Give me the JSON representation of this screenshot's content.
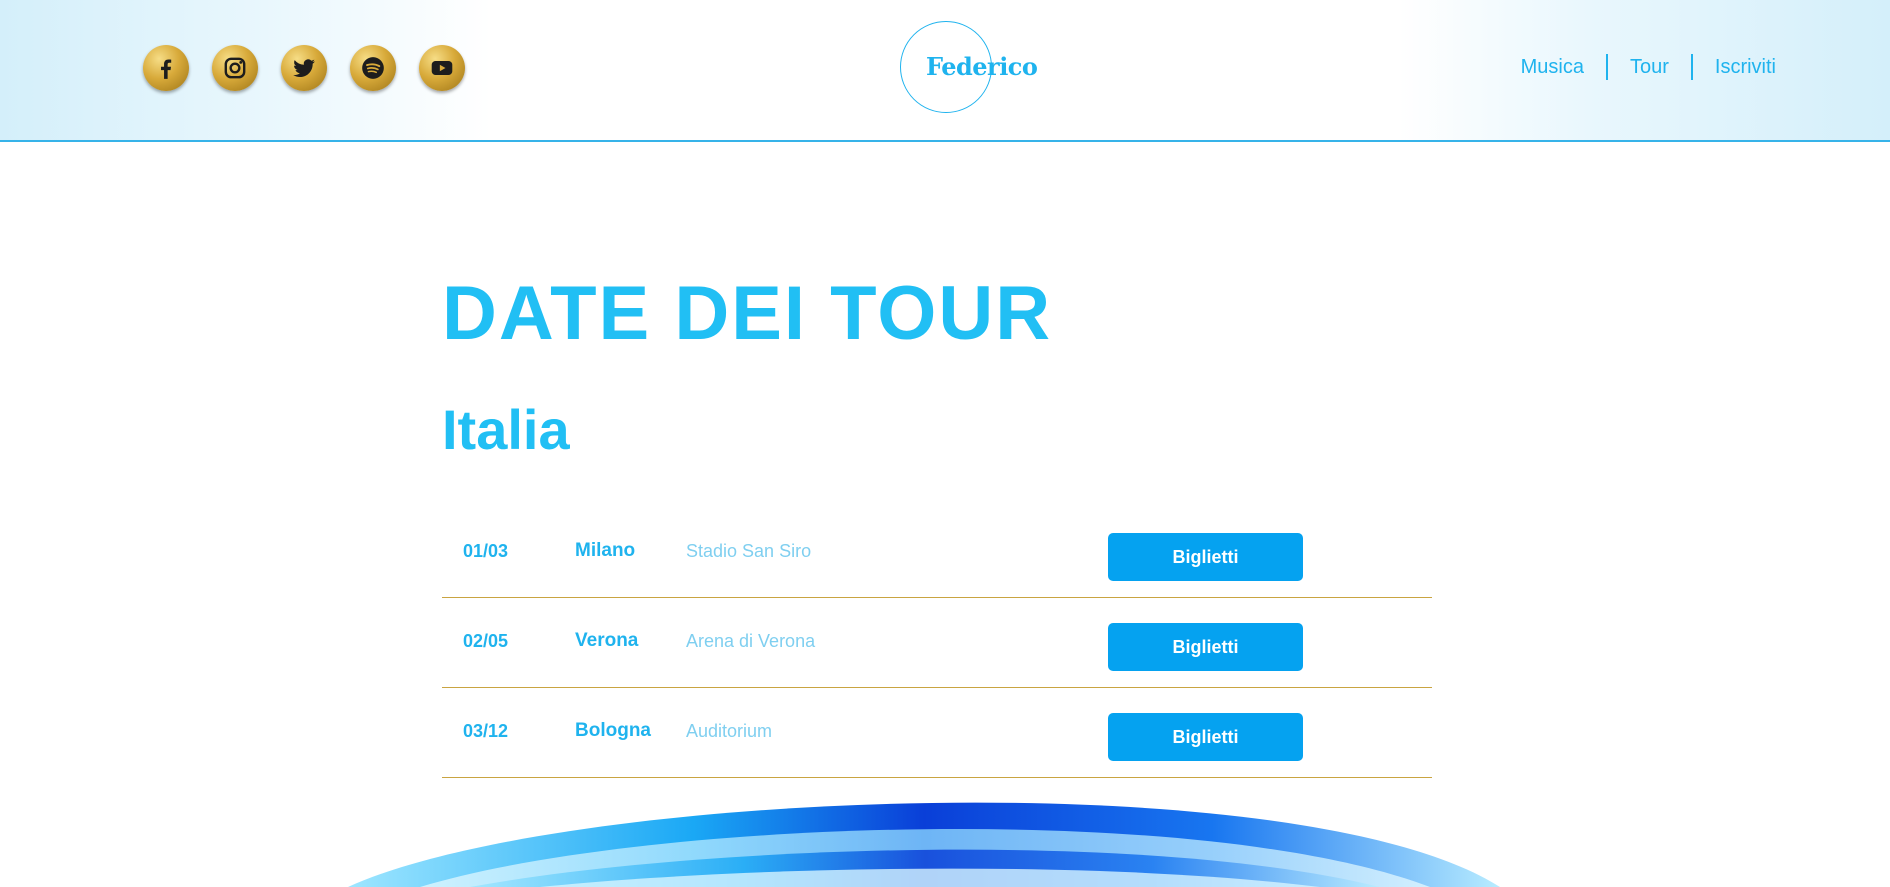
{
  "header": {
    "logo_text": "Federico",
    "socials": [
      {
        "icon": "facebook-icon"
      },
      {
        "icon": "instagram-icon"
      },
      {
        "icon": "twitter-icon"
      },
      {
        "icon": "spotify-icon"
      },
      {
        "icon": "youtube-icon"
      }
    ],
    "nav": [
      {
        "label": "Musica"
      },
      {
        "label": "Tour"
      },
      {
        "label": "Iscriviti"
      }
    ]
  },
  "main": {
    "title": "DATE DEI TOUR",
    "subtitle": "Italia",
    "tour_dates": [
      {
        "date": "01/03",
        "city": "Milano",
        "venue": "Stadio San Siro",
        "button": "Biglietti"
      },
      {
        "date": "02/05",
        "city": "Verona",
        "venue": "Arena di Verona",
        "button": "Biglietti"
      },
      {
        "date": "03/12",
        "city": "Bologna",
        "venue": "Auditorium",
        "button": "Biglietti"
      }
    ]
  },
  "colors": {
    "accent": "#1fb3ee",
    "button": "#05a2f0",
    "divider": "#c9a441",
    "social_gold": "#d8aa3a"
  }
}
